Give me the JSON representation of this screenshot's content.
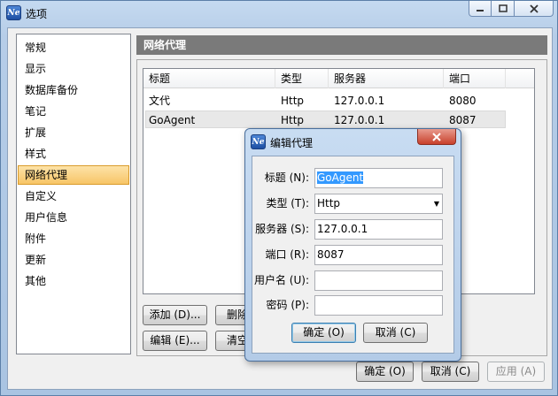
{
  "window": {
    "title": "选项",
    "icon": "Ne"
  },
  "nav": {
    "items": [
      "常规",
      "显示",
      "数据库备份",
      "笔记",
      "扩展",
      "样式",
      "网络代理",
      "自定义",
      "用户信息",
      "附件",
      "更新",
      "其他"
    ],
    "selected_index": 6
  },
  "panel": {
    "title": "网络代理",
    "table": {
      "headers": [
        "标题",
        "类型",
        "服务器",
        "端口"
      ],
      "rows": [
        [
          "文代",
          "Http",
          "127.0.0.1",
          "8080"
        ],
        [
          "GoAgent",
          "Http",
          "127.0.0.1",
          "8087"
        ]
      ]
    },
    "buttons": {
      "add": "添加 (D)...",
      "delete": "删除",
      "edit": "编辑 (E)...",
      "clear": "清空"
    }
  },
  "footer": {
    "ok": "确定 (O)",
    "cancel": "取消 (C)",
    "apply": "应用 (A)"
  },
  "dialog": {
    "title": "编辑代理",
    "icon": "Ne",
    "labels": {
      "title": "标题 (N):",
      "type": "类型 (T):",
      "server": "服务器 (S):",
      "port": "端口 (R):",
      "username": "用户名 (U):",
      "password": "密码 (P):"
    },
    "values": {
      "title": "GoAgent",
      "type": "Http",
      "server": "127.0.0.1",
      "port": "8087",
      "username": "",
      "password": ""
    },
    "ok": "确定 (O)",
    "cancel": "取消 (C)"
  }
}
